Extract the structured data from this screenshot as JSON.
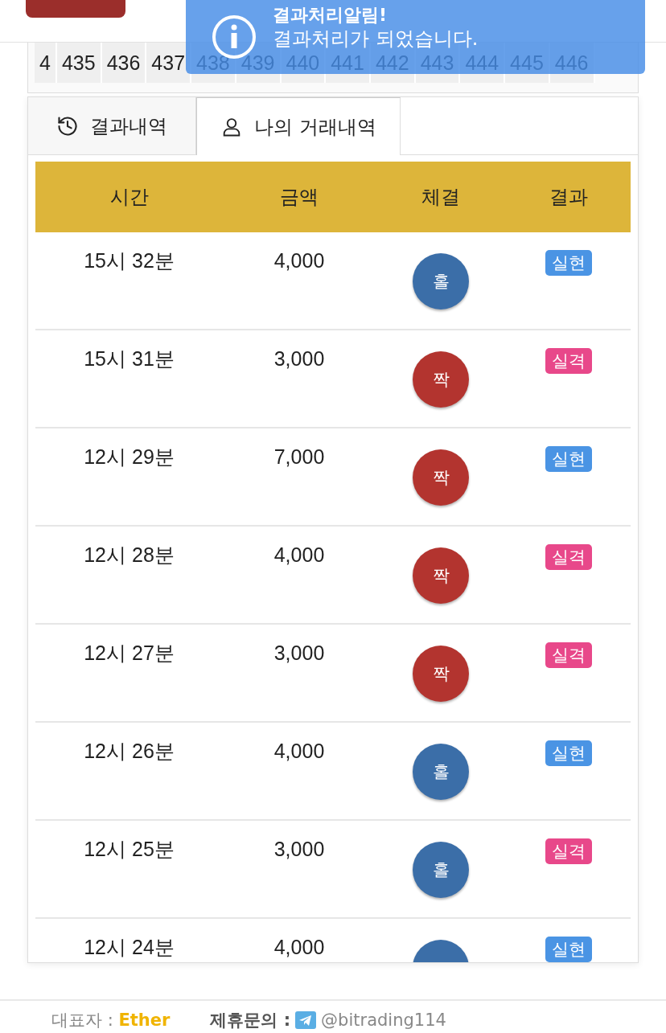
{
  "toast": {
    "title": "결과처리알림!",
    "message": "결과처리가 되었습니다."
  },
  "rounds": [
    "4",
    "435",
    "436",
    "437",
    "438",
    "439",
    "440",
    "441",
    "442",
    "443",
    "444",
    "445",
    "446"
  ],
  "tabs": [
    {
      "label": "결과내역",
      "selected": false
    },
    {
      "label": "나의 거래내역",
      "selected": true
    }
  ],
  "table": {
    "columns": [
      "시간",
      "금액",
      "체결",
      "결과"
    ],
    "rows": [
      {
        "time": "15시 32분",
        "amount": "4,000",
        "pick": {
          "label": "홀",
          "kind": "odd"
        },
        "result": {
          "label": "실현",
          "kind": "win"
        }
      },
      {
        "time": "15시 31분",
        "amount": "3,000",
        "pick": {
          "label": "짝",
          "kind": "even"
        },
        "result": {
          "label": "실격",
          "kind": "lose"
        }
      },
      {
        "time": "12시 29분",
        "amount": "7,000",
        "pick": {
          "label": "짝",
          "kind": "even"
        },
        "result": {
          "label": "실현",
          "kind": "win"
        }
      },
      {
        "time": "12시 28분",
        "amount": "4,000",
        "pick": {
          "label": "짝",
          "kind": "even"
        },
        "result": {
          "label": "실격",
          "kind": "lose"
        }
      },
      {
        "time": "12시 27분",
        "amount": "3,000",
        "pick": {
          "label": "짝",
          "kind": "even"
        },
        "result": {
          "label": "실격",
          "kind": "lose"
        }
      },
      {
        "time": "12시 26분",
        "amount": "4,000",
        "pick": {
          "label": "홀",
          "kind": "odd"
        },
        "result": {
          "label": "실현",
          "kind": "win"
        }
      },
      {
        "time": "12시 25분",
        "amount": "3,000",
        "pick": {
          "label": "홀",
          "kind": "odd"
        },
        "result": {
          "label": "실격",
          "kind": "lose"
        }
      },
      {
        "time": "12시 24분",
        "amount": "4,000",
        "pick": {
          "kind": "odd"
        },
        "result": {
          "label": "실현",
          "kind": "win"
        }
      }
    ]
  },
  "footer": {
    "owner_label": "대표자 :",
    "owner": "Ether",
    "contact_label": "제휴문의 :",
    "contact": "@bitrading114"
  }
}
